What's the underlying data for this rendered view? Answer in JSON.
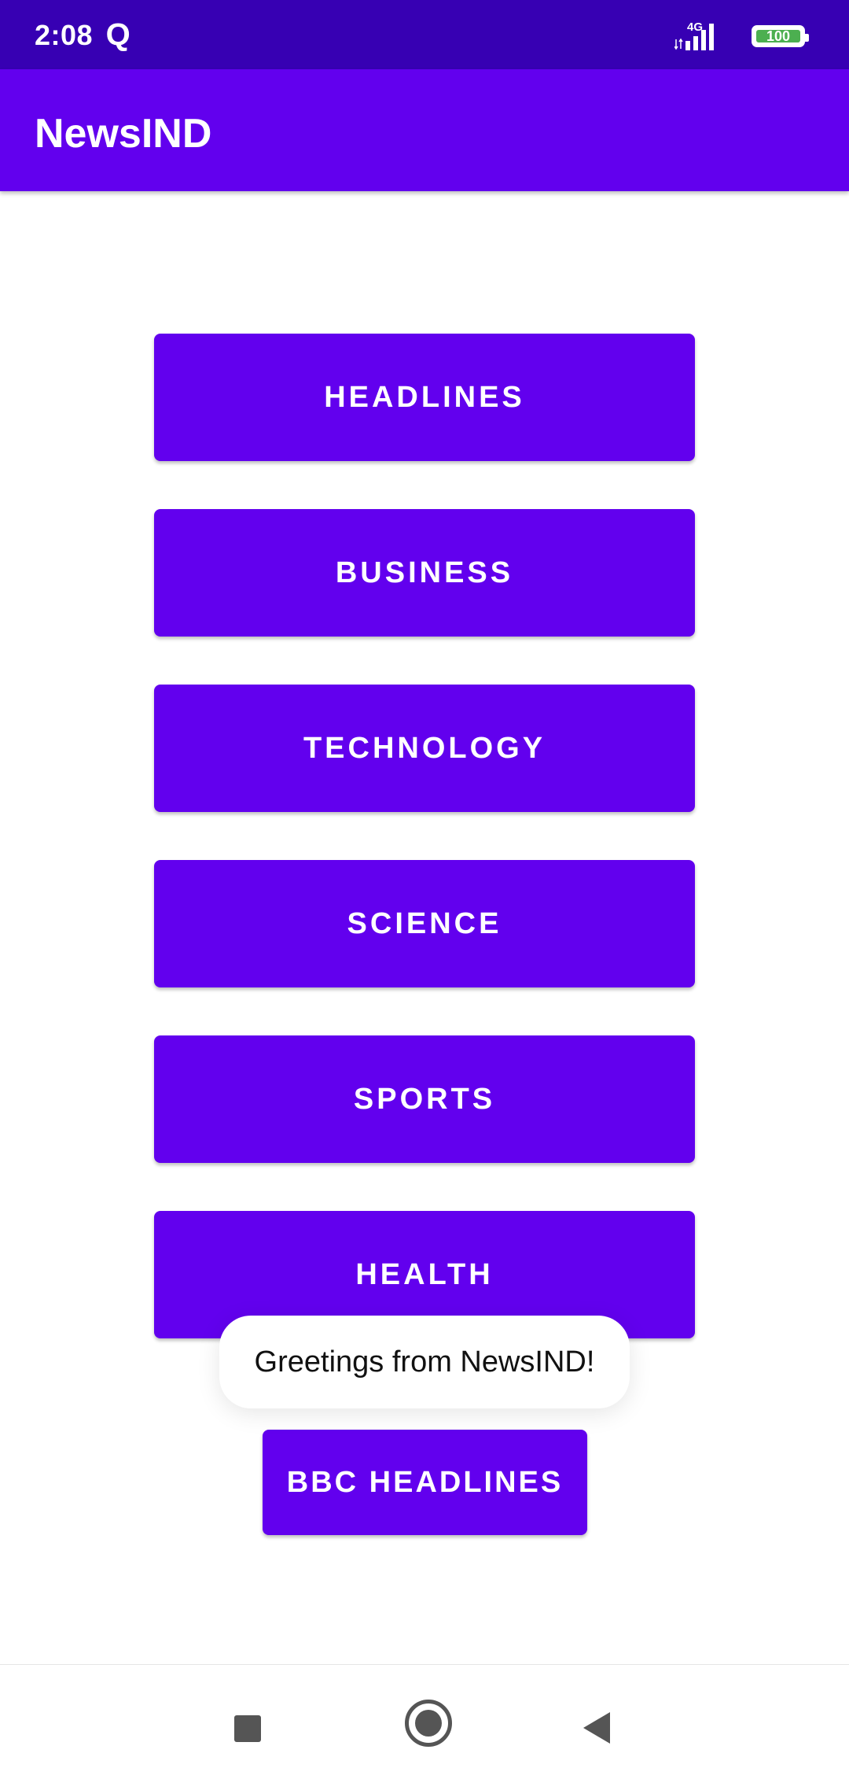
{
  "status_bar": {
    "time": "2:08",
    "extra_icon": "Q",
    "network": "4G",
    "battery": "100",
    "battery_level": 1.0
  },
  "app_bar": {
    "title": "NewsIND"
  },
  "categories": [
    {
      "label": "HEADLINES"
    },
    {
      "label": "BUSINESS"
    },
    {
      "label": "TECHNOLOGY"
    },
    {
      "label": "SCIENCE"
    },
    {
      "label": "SPORTS"
    },
    {
      "label": "HEALTH"
    }
  ],
  "bbc_button": {
    "label": "BBC HEADLINES"
  },
  "toast": {
    "message": "Greetings from NewsIND!"
  },
  "nav_bar": {
    "icons": [
      "recents-square-icon",
      "home-circle-icon",
      "back-triangle-icon"
    ]
  },
  "colors": {
    "primary": "#6200EE",
    "primary_dark": "#3700B3",
    "battery": "#4CAF50"
  }
}
